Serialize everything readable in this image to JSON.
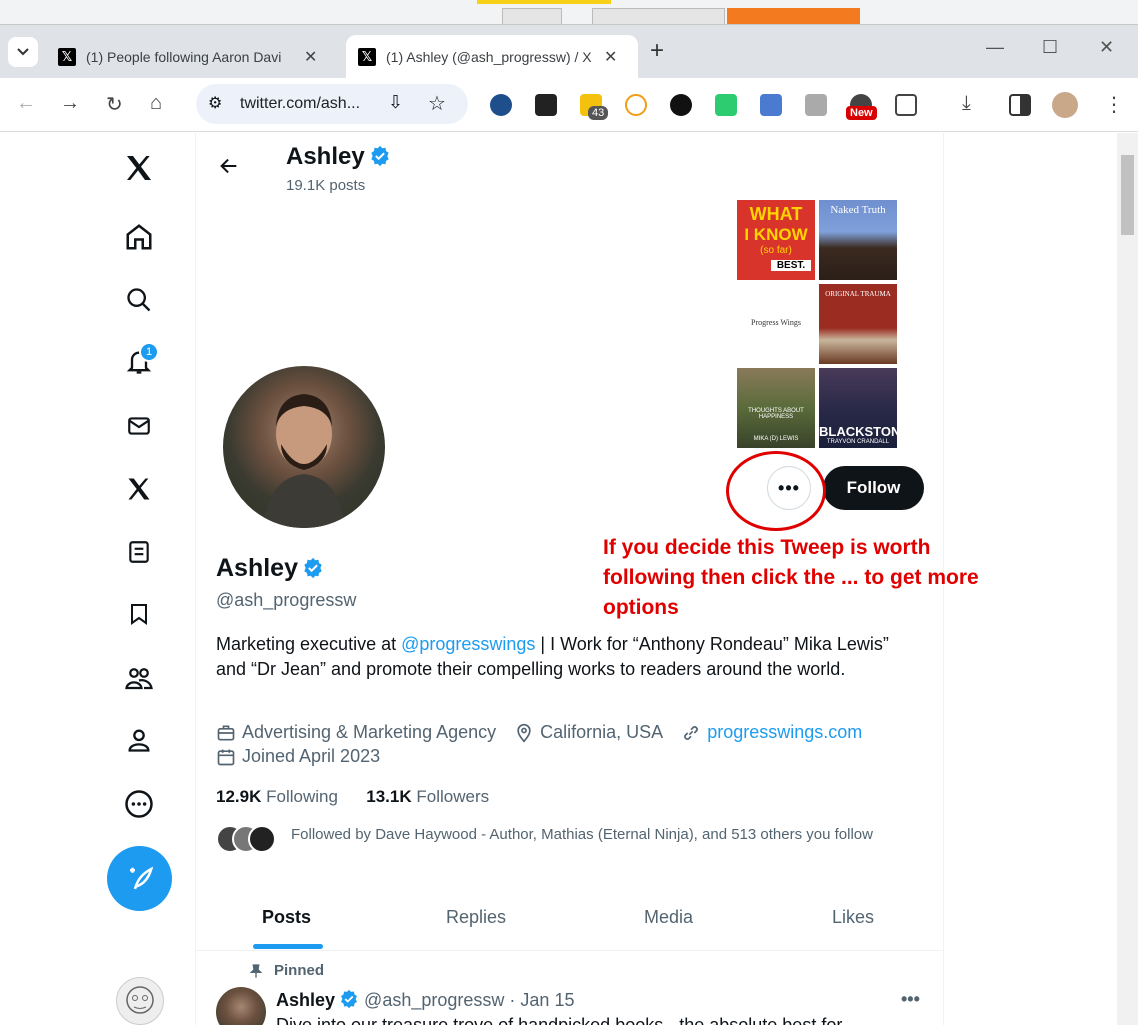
{
  "browser": {
    "tabs": [
      {
        "title": "(1) People following Aaron Davi",
        "close": "✕"
      },
      {
        "title": "(1) Ashley (@ash_progressw) / X",
        "close": "✕"
      }
    ],
    "new_tab": "+",
    "url": "twitter.com/ash...",
    "extensions": {
      "badge_count": "43",
      "new_label": "New"
    }
  },
  "profile_header": {
    "name": "Ashley",
    "posts": "19.1K posts"
  },
  "banner_books": [
    {
      "line1": "WHAT",
      "line2": "I KNOW",
      "line3": "(so far)",
      "line4": "BEST."
    },
    {
      "line1": "Naked Truth"
    },
    {
      "line1": "Progress Wings"
    },
    {
      "line1": "ORIGINAL TRAUMA"
    },
    {
      "line1": "THOUGHTS ABOUT HAPPINESS",
      "line2": "MIKA (D) LEWIS"
    },
    {
      "line1": "BLACKSTONE",
      "line2": "TRAYVON CRANDALL"
    }
  ],
  "actions": {
    "more": "•••",
    "follow": "Follow"
  },
  "annotation": "If you decide this Tweep is worth following then click the ... to get more options",
  "profile": {
    "name": "Ashley",
    "handle": "@ash_progressw",
    "bio_before": "Marketing executive at ",
    "bio_link": "@progresswings",
    "bio_after": " | I Work for “Anthony Rondeau” Mika Lewis” and “Dr Jean” and promote their compelling works to readers around the world.",
    "category": "Advertising & Marketing Agency",
    "location": "California, USA",
    "website": "progresswings.com",
    "joined": "Joined April 2023",
    "following_count": "12.9K",
    "following_label": "Following",
    "followers_count": "13.1K",
    "followers_label": "Followers",
    "followed_by": "Followed by Dave Haywood - Author, Mathias (Eternal Ninja), and 513 others you follow"
  },
  "profile_tabs": [
    {
      "label": "Posts"
    },
    {
      "label": "Replies"
    },
    {
      "label": "Media"
    },
    {
      "label": "Likes"
    }
  ],
  "tweet": {
    "pinned_label": "Pinned",
    "name": "Ashley",
    "handle": "@ash_progressw",
    "sep": "·",
    "date": "Jan 15",
    "more": "•••",
    "text": "Dive into our treasure trove of handpicked books - the absolute best for..."
  },
  "nav": {
    "notification_count": "1"
  },
  "colors": {
    "accent": "#1d9bf0",
    "annotation": "#e00000",
    "follow_button": "#0f1419"
  }
}
